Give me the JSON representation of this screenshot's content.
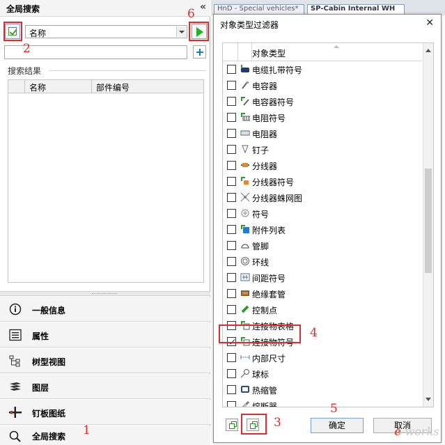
{
  "left_panel": {
    "title": "全局搜索",
    "collapse_glyph": "«",
    "search_field": {
      "selected": "名称"
    },
    "search_input": {
      "value": ""
    },
    "results": {
      "label": "搜索结果",
      "columns": [
        "名称",
        "部件编号"
      ]
    },
    "nav": [
      {
        "label": "一般信息",
        "icon": "info-icon"
      },
      {
        "label": "属性",
        "icon": "properties-icon"
      },
      {
        "label": "树型视图",
        "icon": "tree-view-icon"
      },
      {
        "label": "图层",
        "icon": "layers-icon"
      },
      {
        "label": "钉板图纸",
        "icon": "nailboard-icon"
      },
      {
        "label": "全局搜索",
        "icon": "search-icon"
      }
    ]
  },
  "doc_tabs": [
    "HnD - Special vehicles*",
    "SP-Cabin Internal WH"
  ],
  "dialog": {
    "title": "对象类型过滤器",
    "close_glyph": "✕",
    "column_header": "对象类型",
    "rows": [
      {
        "label": "电缆扎带符号",
        "checked": false,
        "icon": "cable-tie-symbol-icon"
      },
      {
        "label": "电容器",
        "checked": false,
        "icon": "capacitor-icon"
      },
      {
        "label": "电容器符号",
        "checked": false,
        "icon": "capacitor-symbol-icon"
      },
      {
        "label": "电阻符号",
        "checked": false,
        "icon": "resistor-symbol-icon"
      },
      {
        "label": "电阻器",
        "checked": false,
        "icon": "resistor-icon"
      },
      {
        "label": "钉子",
        "checked": false,
        "icon": "nail-icon"
      },
      {
        "label": "分线器",
        "checked": false,
        "icon": "splitter-icon"
      },
      {
        "label": "分线器符号",
        "checked": false,
        "icon": "splitter-symbol-icon"
      },
      {
        "label": "分线器蛛网图",
        "checked": false,
        "icon": "splitter-web-icon"
      },
      {
        "label": "符号",
        "checked": false,
        "icon": "symbol-icon"
      },
      {
        "label": "附件列表",
        "checked": false,
        "icon": "accessory-list-icon"
      },
      {
        "label": "管脚",
        "checked": false,
        "icon": "pin-icon"
      },
      {
        "label": "环线",
        "checked": false,
        "icon": "loop-icon"
      },
      {
        "label": "间距符号",
        "checked": false,
        "icon": "spacing-symbol-icon"
      },
      {
        "label": "绝缘套管",
        "checked": false,
        "icon": "insulation-sleeve-icon"
      },
      {
        "label": "控制点",
        "checked": false,
        "icon": "control-point-icon"
      },
      {
        "label": "连接物表格",
        "checked": false,
        "icon": "connector-table-icon"
      },
      {
        "label": "连接物符号",
        "checked": true,
        "icon": "connector-symbol-icon"
      },
      {
        "label": "内部尺寸",
        "checked": false,
        "icon": "inner-dimension-icon"
      },
      {
        "label": "球标",
        "checked": false,
        "icon": "balloon-icon"
      },
      {
        "label": "热缩管",
        "checked": false,
        "icon": "heat-shrink-icon"
      },
      {
        "label": "熔断器",
        "checked": false,
        "icon": "fuse-icon"
      }
    ],
    "ok_label": "确定",
    "cancel_label": "取消"
  },
  "annotations": [
    "1",
    "2",
    "3",
    "4",
    "5",
    "6"
  ],
  "watermark": {
    "prefix": "e",
    "rest": "-works"
  },
  "colors": {
    "annotation": "#e32a2a",
    "run_green": "#24b024",
    "add_blue": "#1a78c8"
  }
}
